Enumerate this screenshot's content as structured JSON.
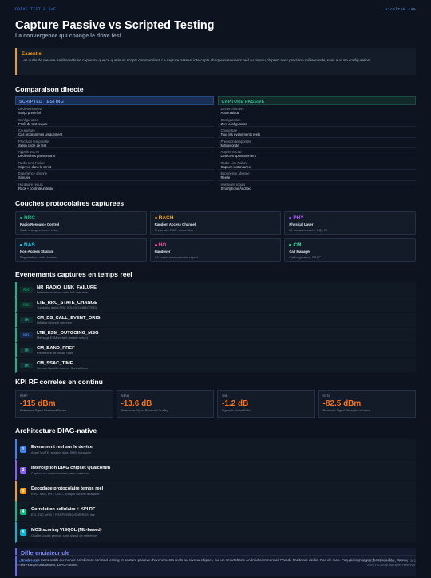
{
  "header": {
    "label": "DRIVE TEST & QoE",
    "site": "hicaltek.com",
    "title": "Capture Passive vs Scripted Testing",
    "subtitle": "La convergence qui change le drive test"
  },
  "essentiel": {
    "heading": "Essentiel",
    "text": "Les outils de mesure traditionnels ne capturent que ce que leurs scripts commandent. La capture passive intercepte chaque evenement reel au niveau chipset, avec precision milliseconde, sans aucune configuration."
  },
  "comparison": {
    "heading": "Comparaison directe",
    "scripted": {
      "title": "SCRIPTED TESTING",
      "rows": [
        {
          "k": "Declenchement",
          "v": "Script predefini"
        },
        {
          "k": "Configuration",
          "v": "Profil de test requis"
        },
        {
          "k": "Couverture",
          "v": "Cas programmes uniquement"
        },
        {
          "k": "Precision temporelle",
          "v": "Selon cycle de test"
        },
        {
          "k": "Appels VoLTE",
          "v": "Declenches par scenario"
        },
        {
          "k": "Radio Link Failure",
          "v": "Si prevu dans le script"
        },
        {
          "k": "Experience abonne",
          "v": "Simulee"
        },
        {
          "k": "Hardware requis",
          "v": "Rack + controleur dedie"
        }
      ]
    },
    "passive": {
      "title": "CAPTURE PASSIVE",
      "rows": [
        {
          "k": "Declenchement",
          "v": "Automatique"
        },
        {
          "k": "Configuration",
          "v": "Zero configuration"
        },
        {
          "k": "Couverture",
          "v": "Tous les evenements reels"
        },
        {
          "k": "Precision temporelle",
          "v": "Milliseconde"
        },
        {
          "k": "Appels VoLTE",
          "v": "Detectes spontanement"
        },
        {
          "k": "Radio Link Failure",
          "v": "Capture instantanee"
        },
        {
          "k": "Experience abonne",
          "v": "Reelle"
        },
        {
          "k": "Hardware requis",
          "v": "Smartphone Android"
        }
      ]
    }
  },
  "layers": {
    "heading": "Couches protocolaires capturees",
    "items": [
      {
        "name": "RRC",
        "full": "Radio Resource Control",
        "desc": "State changes, conn. setup",
        "color": "#10b981"
      },
      {
        "name": "RACH",
        "full": "Random Access Channel",
        "desc": "Preamble, RAR, contention",
        "color": "#f59e0b"
      },
      {
        "name": "PHY",
        "full": "Physical Layer",
        "desc": "L1 measurements, CQI, RI",
        "color": "#a855f7"
      },
      {
        "name": "NAS",
        "full": "Non-Access Stratum",
        "desc": "Registration, auth, bearers",
        "color": "#22d3ee"
      },
      {
        "name": "HO",
        "full": "Handover",
        "desc": "A3 event, measurement report",
        "color": "#ec4899"
      },
      {
        "name": "CM",
        "full": "Call Manager",
        "desc": "Call origination, SSAC",
        "color": "#34d399"
      }
    ]
  },
  "events": {
    "heading": "Evenements captures en temps reel",
    "items": [
      {
        "tag": "RRC",
        "name": "NR_RADIO_LINK_FAILURE",
        "desc": "Defaillance liaison radio NR detectee"
      },
      {
        "tag": "RRC",
        "name": "LTE_RRC_STATE_CHANGE",
        "desc": "Transition d'etat RRC (IDLE/CONNECTED)"
      },
      {
        "tag": "CM",
        "name": "CM_DS_CALL_EVENT_ORIG",
        "desc": "Initiation d'appel detectee"
      },
      {
        "tag": "NAS",
        "name": "LTE_ESM_OUTGOING_MSG",
        "desc": "Message ESM sortant (bearer setup)"
      },
      {
        "tag": "CM",
        "name": "CM_BAND_PREF",
        "desc": "Preference de bande radio"
      },
      {
        "tag": "CM",
        "name": "CM_SSAC_TIME",
        "desc": "Service-Specific Access Control timer"
      }
    ]
  },
  "kpi": {
    "heading": "KPI RF correles en continu",
    "items": [
      {
        "label": "RSRP",
        "value": "-115 dBm",
        "desc": "Reference Signal Received Power"
      },
      {
        "label": "RSRQ",
        "value": "-13.6 dB",
        "desc": "Reference Signal Received Quality"
      },
      {
        "label": "SNR",
        "value": "-1.2 dB",
        "desc": "Signal-to-Noise Ratio"
      },
      {
        "label": "RSSI",
        "value": "-82.5 dBm",
        "desc": "Received Signal Strength Indicator"
      }
    ]
  },
  "architecture": {
    "heading": "Architecture DIAG-native",
    "steps": [
      {
        "n": "1",
        "name": "Evenement reel sur le device",
        "desc": "Appel VoLTE, session data, SMS, handover",
        "color": "#3b82f6"
      },
      {
        "n": "2",
        "name": "Interception DIAG chipset Qualcomm",
        "desc": "Capture au niveau modem, zero overhead",
        "color": "#8b5cf6"
      },
      {
        "n": "3",
        "name": "Decodage protocolaire temps reel",
        "desc": "RRC, NAS, PHY, CM — chaque couche analysee",
        "color": "#f59e0b"
      },
      {
        "n": "4",
        "name": "Correlation cellulaire + KPI RF",
        "desc": "ECI, TAC, eNB + RSRP/RSRQ/SNR/RSSI live",
        "color": "#10b981"
      },
      {
        "n": "5",
        "name": "MOS scoring VISQOL (ML-based)",
        "desc": "Qualite vocale percue, sans signal de reference",
        "color": "#06b6d4"
      }
    ]
  },
  "differentiator": {
    "heading": "Differenciateur cle",
    "text": "Un des tres rares outils au monde combinant scripted testing et capture passive d'evenements reels au niveau chipset, sur un smartphone Android commercial. Pas de hardware dedie. Pas de rack. Pas de licence par fonctionnalite. Concu en France, souverain, DIAG-native."
  },
  "footer": {
    "site": "hicaltek.com",
    "product": "Network Diagnostics Suite",
    "refs": "3GPP TS 36.331, TS 38.331, TS 24.301",
    "copy": "2026 HiCalTek. All rights reserved."
  }
}
